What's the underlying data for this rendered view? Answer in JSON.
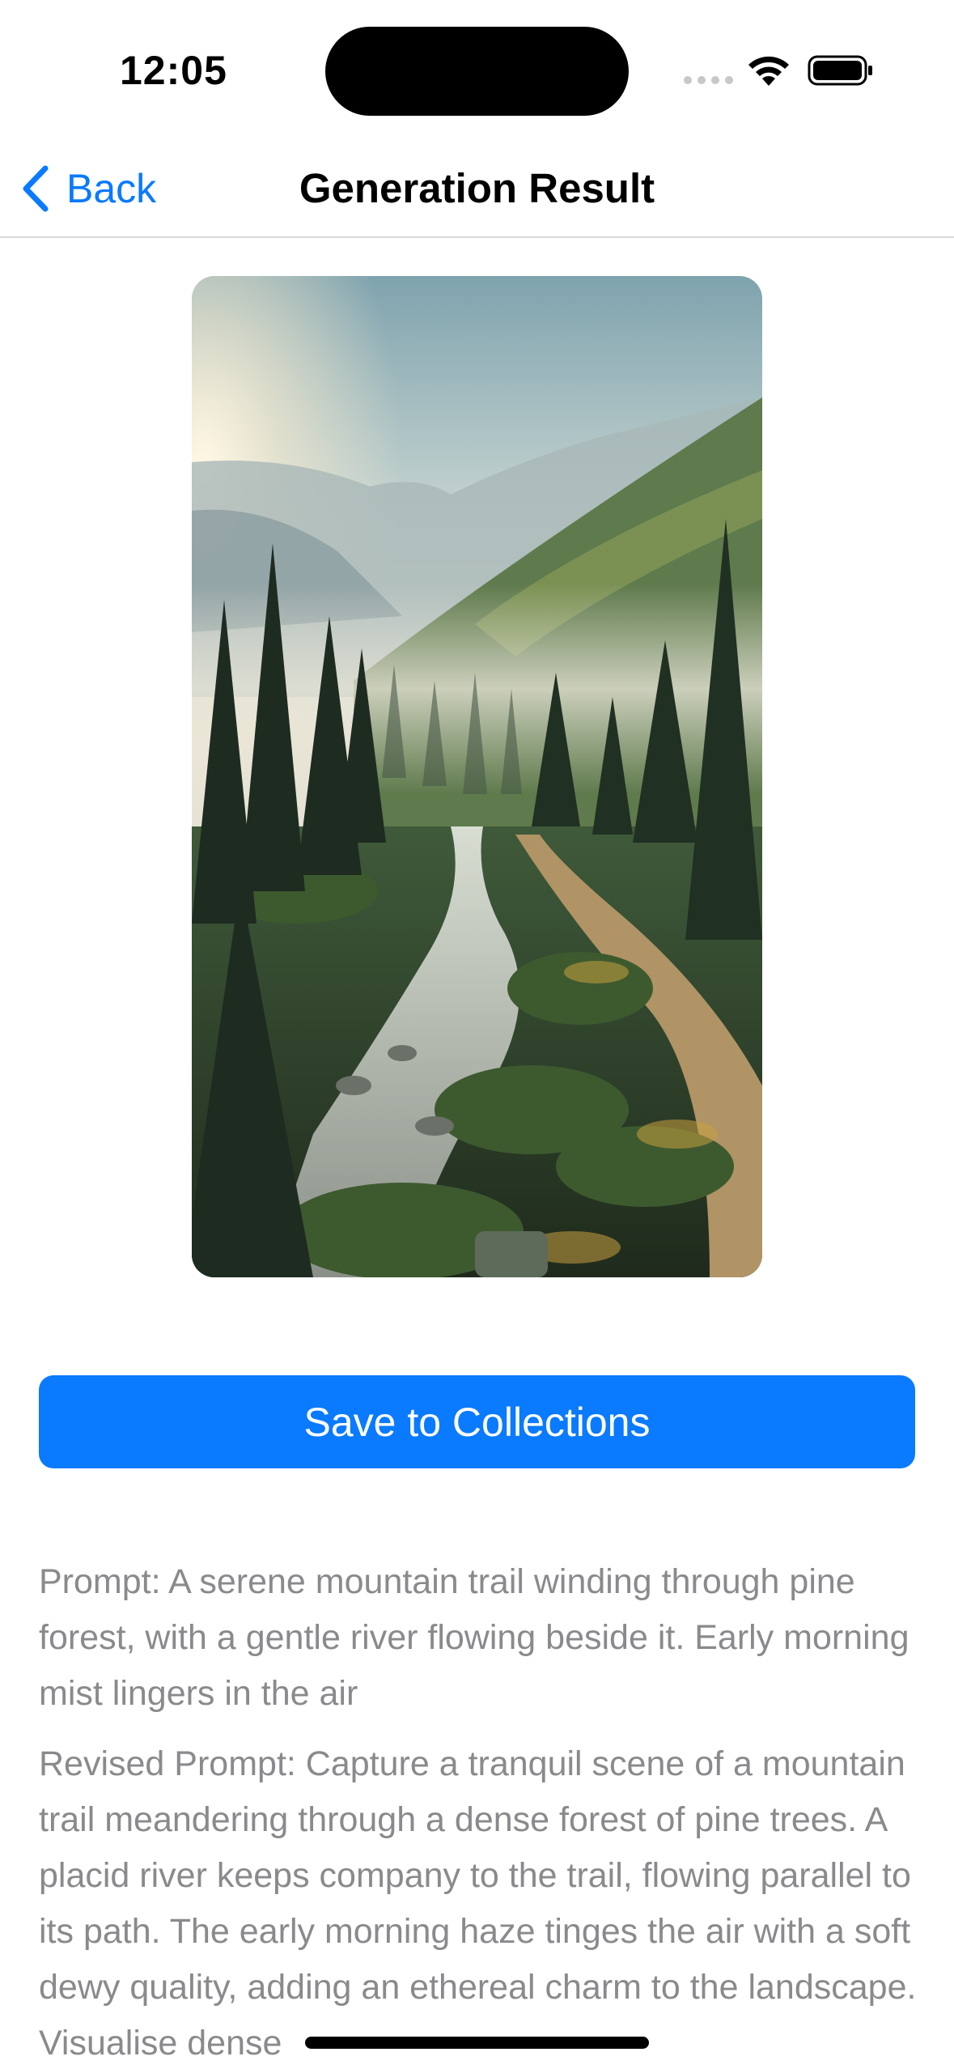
{
  "status_bar": {
    "time": "12:05",
    "signal_icon": "cellular-signal-icon",
    "wifi_icon": "wifi-icon",
    "battery_icon": "battery-icon"
  },
  "nav": {
    "back_label": "Back",
    "back_icon": "chevron-left-icon",
    "title": "Generation Result"
  },
  "image": {
    "alt": "mountain-trail-pine-forest-river"
  },
  "actions": {
    "save_label": "Save to Collections"
  },
  "prompt": {
    "text": "Prompt: A serene mountain trail winding through pine forest, with a gentle river flowing beside it. Early morning mist lingers in the air",
    "revised": "Revised Prompt: Capture a tranquil scene of a mountain trail meandering through a dense forest of pine trees. A placid river keeps company to the trail, flowing parallel to its path. The early morning haze tinges the air with a soft dewy quality, adding an ethereal charm to the landscape. Visualise dense"
  },
  "colors": {
    "accent": "#0a7aff",
    "secondary_text": "#8a8a8e",
    "divider": "#d8d8dc"
  }
}
